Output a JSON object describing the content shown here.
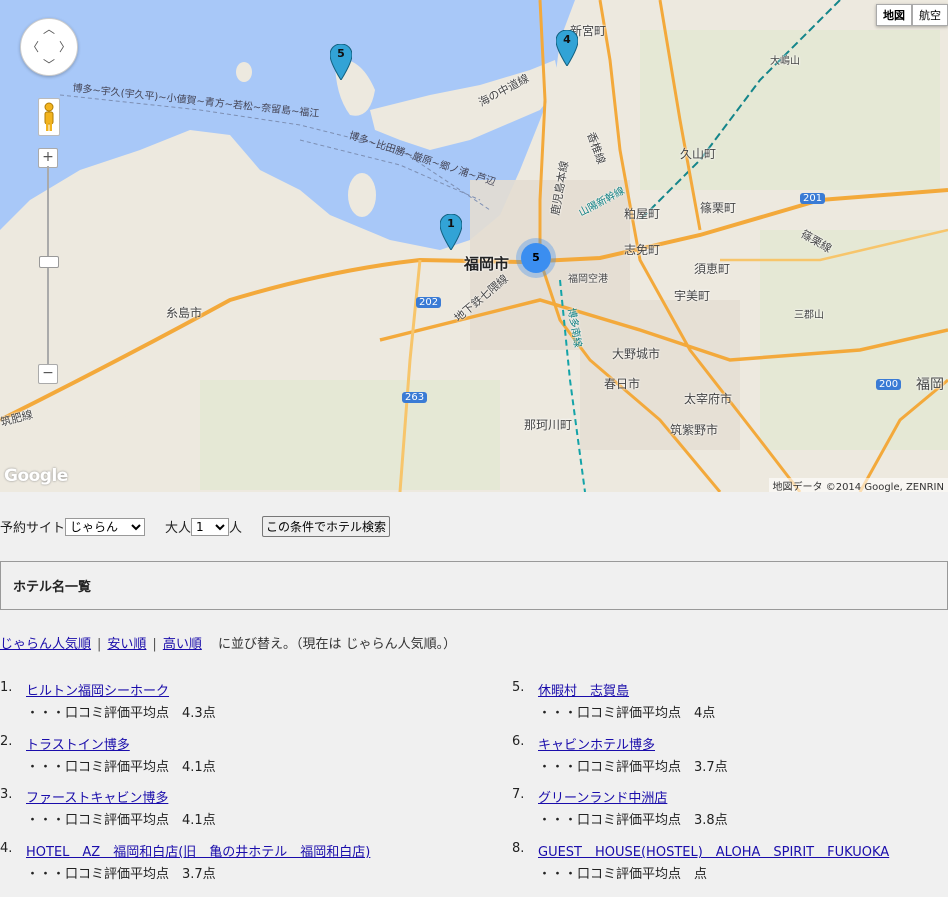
{
  "map": {
    "type_buttons": [
      "地図",
      "航空"
    ],
    "attribution": "地図データ ©2014 Google, ZENRIN",
    "logo": "Google",
    "zoom_in": "+",
    "zoom_out": "−",
    "places": {
      "fukuoka": "福岡市",
      "itoshima": "糸島市",
      "onojo": "大野城市",
      "kasuga": "春日市",
      "dazaifu": "太宰府市",
      "chikushino": "筑紫野市",
      "nakagawa": "那珂川町",
      "shingu": "新宮町",
      "hisayama": "久山町",
      "kasuya": "粕屋町",
      "sasaguri": "篠栗町",
      "shime": "志免町",
      "sue": "須恵町",
      "umi": "宇美町",
      "airport": "福岡空港",
      "fukuoka_right": "福岡",
      "sanroku": "三郡山",
      "ochin": "大嶋山",
      "sea_route1": "博多~宇久(宇久平)~小値賀~青方~若松~奈留島~福江",
      "sea_route2": "博多~比田勝~厳原~郷ノ浦~芦辺",
      "line_umi": "海の中道線",
      "line_kashii": "香椎線",
      "line_kagoshima": "鹿児島本線",
      "line_subway": "地下鉄七隈線",
      "line_chikuhi": "筑肥線",
      "line_sasaguri": "篠栗線",
      "line_sanyo": "山陽新幹線",
      "line_hakata": "博多南線"
    },
    "shields": [
      "202",
      "263",
      "201",
      "200"
    ],
    "pins": [
      "5",
      "4",
      "1"
    ],
    "cluster": "5"
  },
  "search": {
    "site_label": "予約サイト",
    "site_value": "じゃらん",
    "adult_label": "大人",
    "adult_value": "1",
    "person_unit": "人",
    "button": "この条件でホテル検索"
  },
  "list": {
    "title": "ホテル名一覧",
    "sort_links": [
      "じゃらん人気順",
      "安い順",
      "高い順"
    ],
    "sort_suffix": "に並び替え。（現在は じゃらん人気順。）",
    "hotels": [
      {
        "idx": "1.",
        "name": "ヒルトン福岡シーホーク",
        "rating": "・・・口コミ評価平均点　4.3点"
      },
      {
        "idx": "2.",
        "name": "トラストイン博多",
        "rating": "・・・口コミ評価平均点　4.1点"
      },
      {
        "idx": "3.",
        "name": "ファーストキャビン博多",
        "rating": "・・・口コミ評価平均点　4.1点"
      },
      {
        "idx": "4.",
        "name": "HOTEL　AZ　福岡和白店(旧　亀の井ホテル　福岡和白店)",
        "rating": "・・・口コミ評価平均点　3.7点"
      },
      {
        "idx": "5.",
        "name": "休暇村　志賀島",
        "rating": "・・・口コミ評価平均点　4点"
      },
      {
        "idx": "6.",
        "name": "キャビンホテル博多",
        "rating": "・・・口コミ評価平均点　3.7点"
      },
      {
        "idx": "7.",
        "name": "グリーンランド中洲店",
        "rating": "・・・口コミ評価平均点　3.8点"
      },
      {
        "idx": "8.",
        "name": "GUEST　HOUSE(HOSTEL)　ALOHA　SPIRIT　FUKUOKA",
        "rating": "・・・口コミ評価平均点　点"
      }
    ]
  }
}
